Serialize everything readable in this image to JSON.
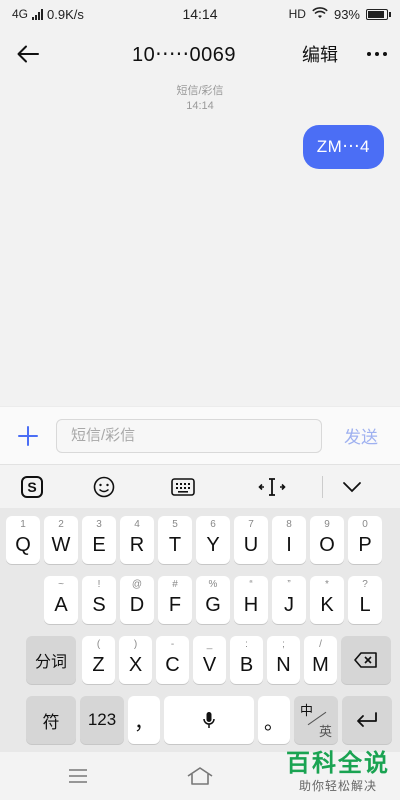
{
  "status_bar": {
    "network": "4G",
    "speed": "0.9K/s",
    "time": "14:14",
    "hd": "HD",
    "battery_text": "93%",
    "battery_level": 0.93
  },
  "header": {
    "title": "10‧‧‧‧‧0069",
    "edit_label": "编辑"
  },
  "conversation": {
    "meta_type": "短信/彩信",
    "meta_time": "14:14",
    "messages": [
      {
        "text": "ZM‧‧‧4",
        "direction": "outgoing"
      }
    ]
  },
  "composer": {
    "placeholder": "短信/彩信",
    "value": "",
    "send_label": "发送"
  },
  "keyboard": {
    "row1": [
      {
        "hint": "1",
        "key": "Q"
      },
      {
        "hint": "2",
        "key": "W"
      },
      {
        "hint": "3",
        "key": "E"
      },
      {
        "hint": "4",
        "key": "R"
      },
      {
        "hint": "5",
        "key": "T"
      },
      {
        "hint": "6",
        "key": "Y"
      },
      {
        "hint": "7",
        "key": "U"
      },
      {
        "hint": "8",
        "key": "I"
      },
      {
        "hint": "9",
        "key": "O"
      },
      {
        "hint": "0",
        "key": "P"
      }
    ],
    "row2": [
      {
        "hint": "~",
        "key": "A"
      },
      {
        "hint": "!",
        "key": "S"
      },
      {
        "hint": "@",
        "key": "D"
      },
      {
        "hint": "#",
        "key": "F"
      },
      {
        "hint": "%",
        "key": "G"
      },
      {
        "hint": "“",
        "key": "H"
      },
      {
        "hint": "”",
        "key": "J"
      },
      {
        "hint": "*",
        "key": "K"
      },
      {
        "hint": "?",
        "key": "L"
      }
    ],
    "row3": [
      {
        "hint": "(",
        "key": "Z"
      },
      {
        "hint": ")",
        "key": "X"
      },
      {
        "hint": "-",
        "key": "C"
      },
      {
        "hint": "_",
        "key": "V"
      },
      {
        "hint": ":",
        "key": "B"
      },
      {
        "hint": ";",
        "key": "N"
      },
      {
        "hint": "/",
        "key": "M"
      }
    ],
    "fenci_label": "分词",
    "symbol_label": "符",
    "num_label": "123",
    "comma_label": "，",
    "period_label": "。",
    "zh_label": "中",
    "en_label": "英"
  },
  "watermark": {
    "top": "百科全说",
    "bottom": "助你轻松解决"
  },
  "colors": {
    "accent": "#4b6ef5",
    "send_disabled": "#9fb1f0",
    "watermark_green": "#1aa352"
  }
}
